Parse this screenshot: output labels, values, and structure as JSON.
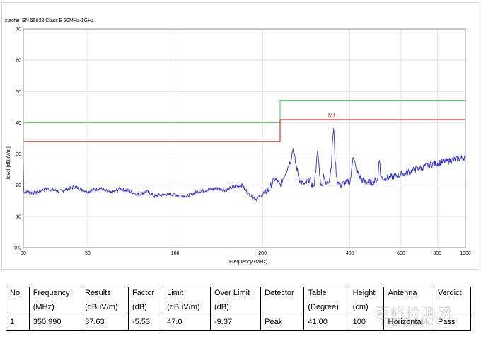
{
  "chart_data": {
    "type": "line",
    "title": "xiaofei_EN 55032 Class B 30MHz-1GHz",
    "xlabel": "Frequency (MHz)",
    "ylabel": "level (dBuV/m)",
    "xscale": "log",
    "xlim": [
      30,
      1000
    ],
    "ylim": [
      0,
      70
    ],
    "xticks": [
      30,
      50,
      100,
      200,
      400,
      600,
      800,
      1000
    ],
    "yticks": [
      0,
      10,
      20,
      30,
      40,
      50,
      60,
      70
    ],
    "ytick_labels": [
      "0.0",
      "10",
      "20",
      "30",
      "40",
      "50",
      "60",
      "70"
    ],
    "grid": true,
    "series": [
      {
        "color": "#3333dd",
        "x": [
          30,
          33,
          36,
          40,
          45,
          50,
          55,
          60,
          65,
          70,
          75,
          80,
          85,
          90,
          100,
          110,
          120,
          130,
          140,
          150,
          160,
          170,
          180,
          190,
          200,
          210,
          220,
          230,
          240,
          250,
          255,
          260,
          265,
          270,
          280,
          290,
          300,
          310,
          315,
          320,
          325,
          330,
          340,
          345,
          350,
          352,
          355,
          360,
          370,
          380,
          390,
          400,
          405,
          410,
          420,
          440,
          460,
          480,
          500,
          505,
          510,
          520,
          550,
          600,
          650,
          700,
          750,
          800,
          850,
          900,
          950,
          1000
        ],
        "y": [
          18,
          17.5,
          19,
          18,
          19.5,
          18,
          19,
          17.5,
          19,
          18,
          17,
          18,
          16.5,
          17,
          17,
          16.5,
          18,
          18.5,
          19,
          18.5,
          19.5,
          20,
          17,
          15.5,
          17,
          18.5,
          22,
          20,
          24,
          28,
          32,
          27,
          24,
          21,
          20,
          22,
          19,
          31,
          23,
          19,
          24,
          20,
          22,
          26,
          37,
          37.5,
          30,
          22,
          20,
          20.5,
          21,
          21,
          24,
          30,
          25,
          21.5,
          21,
          21,
          22,
          30,
          23,
          22,
          22.5,
          23.5,
          24.5,
          25.5,
          26.5,
          27,
          27.5,
          28,
          28.5,
          29
        ]
      }
    ],
    "limit_lines": [
      {
        "color": "#5fd35f",
        "segments": [
          [
            30,
            40
          ],
          [
            230,
            40
          ],
          [
            230,
            47
          ],
          [
            1000,
            47
          ]
        ]
      },
      {
        "color": "#e03030",
        "segments": [
          [
            30,
            34
          ],
          [
            230,
            34
          ],
          [
            230,
            41
          ],
          [
            1000,
            41
          ]
        ]
      }
    ],
    "markers": [
      {
        "label": "M1",
        "x": 350.99,
        "y": 37.63,
        "color": "#dd2222"
      }
    ]
  },
  "table": {
    "headers_line1": [
      "No.",
      "Frequency",
      "Results",
      "Factor",
      "Limit",
      "Over Limit",
      "Detector",
      "Table",
      "Height",
      "Antenna",
      "Verdict"
    ],
    "headers_line2": [
      "",
      "(MHz)",
      "(dBuV/m)",
      "(dB)",
      "(dBuV/m)",
      "(dB)",
      "",
      "(Degree)",
      "(cm)",
      "",
      ""
    ],
    "rows": [
      [
        "1",
        "350.990",
        "37.63",
        "-5.53",
        "47.0",
        "-9.37",
        "Peak",
        "41.00",
        "100",
        "Horizontal",
        "Pass"
      ]
    ]
  },
  "watermark": {
    "text": "嘉峪检测网",
    "subtext": "翔略科技EMC"
  }
}
